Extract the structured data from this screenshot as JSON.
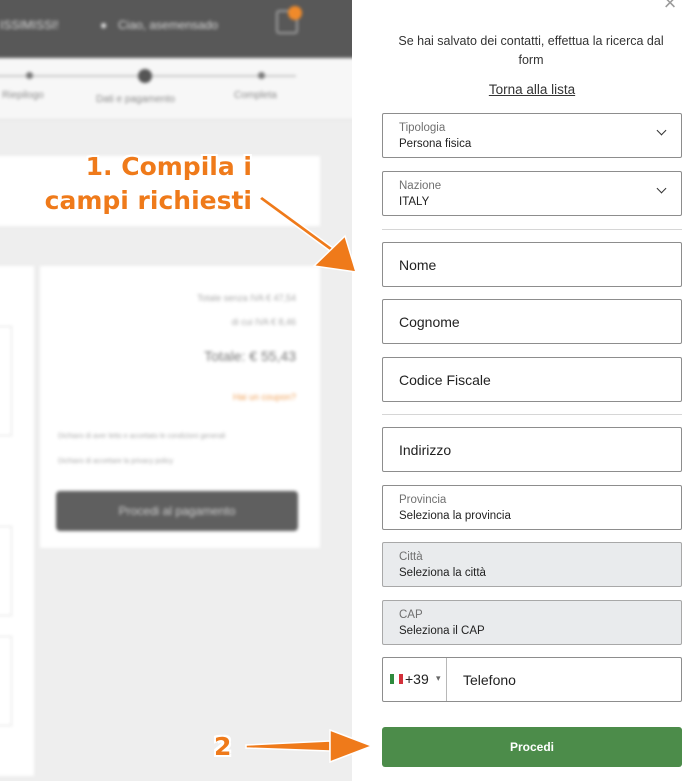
{
  "background": {
    "header_left": "ISSIMISSI!",
    "header_user": "Ciao, asemensado",
    "steps": [
      "Riepilogo",
      "Dati e pagamento",
      "Completa"
    ],
    "summary_lines": [
      "Totale senza IVA € 47,54",
      "di cui IVA € 8,46",
      "Totale: € 55,43"
    ],
    "summary_link": "Hai un coupon?",
    "checkbox_text_1": "Dichiaro di aver letto e accettato le condizioni generali",
    "checkbox_text_2": "Dichiaro di accettare la privacy policy",
    "pay_button": "Procedi al pagamento"
  },
  "annotations": {
    "step1_line1": "1. Compila i",
    "step1_line2": "campi richiesti",
    "step2": "2",
    "color": "#ef7a1a"
  },
  "panel": {
    "close": "×",
    "intro": "Se hai salvato dei contatti, effettua la ricerca dal form",
    "back_link": "Torna alla lista",
    "tipologia": {
      "label": "Tipologia",
      "value": "Persona fisica"
    },
    "nazione": {
      "label": "Nazione",
      "value": "ITALY"
    },
    "nome": "Nome",
    "cognome": "Cognome",
    "codice_fiscale": "Codice Fiscale",
    "indirizzo": "Indirizzo",
    "provincia": {
      "label": "Provincia",
      "value": "Seleziona la provincia"
    },
    "citta": {
      "label": "Città",
      "value": "Seleziona la città"
    },
    "cap": {
      "label": "CAP",
      "value": "Seleziona il CAP"
    },
    "phone": {
      "prefix": "+39",
      "caret": "▾",
      "placeholder": "Telefono"
    },
    "submit": "Procedi",
    "submit_color": "#4c8c4a"
  }
}
